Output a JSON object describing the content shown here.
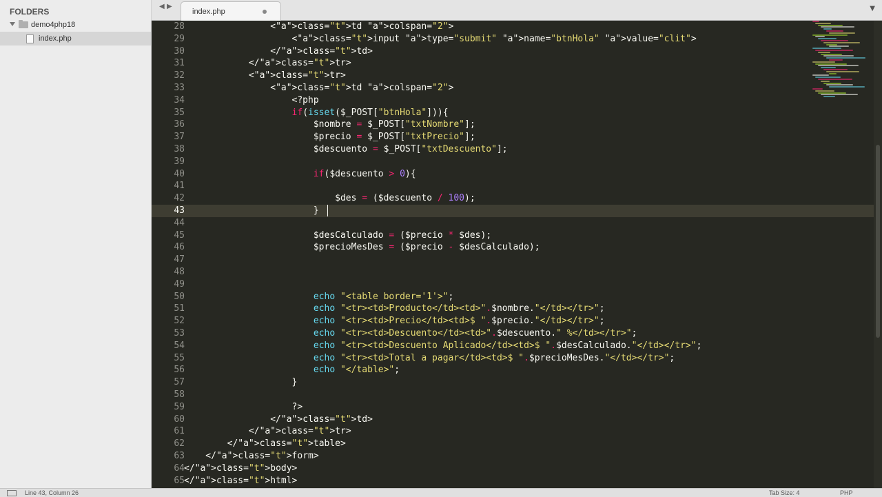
{
  "sidebar": {
    "title": "FOLDERS",
    "folder": "demo4php18",
    "file": "index.php"
  },
  "tab": {
    "label": "index.php"
  },
  "status": {
    "position": "Line 43, Column 26",
    "tab_size": "Tab Size: 4",
    "syntax": "PHP"
  },
  "icons": {
    "nav_left": "arrow-left-icon",
    "nav_right": "arrow-right-icon",
    "tab_menu": "chevron-down-icon",
    "folder": "folder-icon",
    "file": "file-icon"
  },
  "colors": {
    "background": "#272822",
    "tag": "#f92672",
    "attribute": "#a6e22e",
    "string": "#e6db74",
    "builtin": "#66d9ef",
    "number": "#ae81ff",
    "text": "#f8f8f2"
  },
  "editor": {
    "active_line": 43,
    "lines": [
      {
        "n": "28",
        "t": "                <td colspan=\"2\">"
      },
      {
        "n": "29",
        "t": "                    <input type=\"submit\" name=\"btnHola\" value=\"clit\">"
      },
      {
        "n": "30",
        "t": "                </td>"
      },
      {
        "n": "31",
        "t": "            </tr>"
      },
      {
        "n": "32",
        "t": "            <tr>"
      },
      {
        "n": "33",
        "t": "                <td colspan=\"2\">"
      },
      {
        "n": "34",
        "t": "                    <?php"
      },
      {
        "n": "35",
        "t": "                    if(isset($_POST[\"btnHola\"])){"
      },
      {
        "n": "36",
        "t": "                        $nombre = $_POST[\"txtNombre\"];"
      },
      {
        "n": "37",
        "t": "                        $precio = $_POST[\"txtPrecio\"];"
      },
      {
        "n": "38",
        "t": "                        $descuento = $_POST[\"txtDescuento\"];"
      },
      {
        "n": "39",
        "t": ""
      },
      {
        "n": "40",
        "t": "                        if($descuento > 0){"
      },
      {
        "n": "41",
        "t": ""
      },
      {
        "n": "42",
        "t": "                            $des = ($descuento / 100);"
      },
      {
        "n": "43",
        "t": "                        }"
      },
      {
        "n": "44",
        "t": ""
      },
      {
        "n": "45",
        "t": "                        $desCalculado = ($precio * $des);"
      },
      {
        "n": "46",
        "t": "                        $precioMesDes = ($precio - $desCalculado);"
      },
      {
        "n": "47",
        "t": ""
      },
      {
        "n": "48",
        "t": ""
      },
      {
        "n": "49",
        "t": ""
      },
      {
        "n": "50",
        "t": "                        echo \"<table border='1'>\";"
      },
      {
        "n": "51",
        "t": "                        echo \"<tr><td>Producto</td><td>\".$nombre.\"</td></tr>\";"
      },
      {
        "n": "52",
        "t": "                        echo \"<tr><td>Precio</td><td>$ \".$precio.\"</td></tr>\";"
      },
      {
        "n": "53",
        "t": "                        echo \"<tr><td>Descuento</td><td>\".$descuento.\" %</td></tr>\";"
      },
      {
        "n": "54",
        "t": "                        echo \"<tr><td>Descuento Aplicado</td><td>$ \".$desCalculado.\"</td></tr>\";"
      },
      {
        "n": "55",
        "t": "                        echo \"<tr><td>Total a pagar</td><td>$ \".$precioMesDes.\"</td></tr>\";"
      },
      {
        "n": "56",
        "t": "                        echo \"</table>\";"
      },
      {
        "n": "57",
        "t": "                    }"
      },
      {
        "n": "58",
        "t": ""
      },
      {
        "n": "59",
        "t": "                    ?>"
      },
      {
        "n": "60",
        "t": "                </td>"
      },
      {
        "n": "61",
        "t": "            </tr>"
      },
      {
        "n": "62",
        "t": "        </table>"
      },
      {
        "n": "63",
        "t": "    </form>"
      },
      {
        "n": "64",
        "t": "</body>"
      },
      {
        "n": "65",
        "t": "</html>"
      }
    ]
  }
}
